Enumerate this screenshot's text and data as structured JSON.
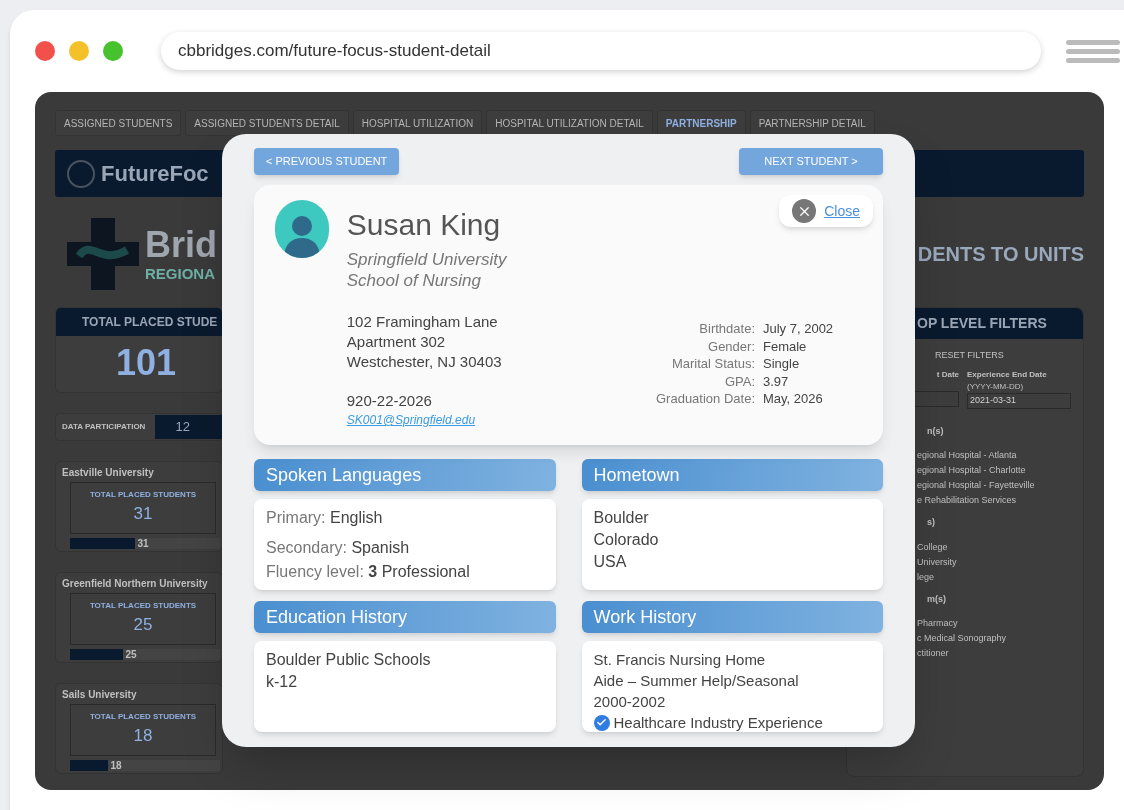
{
  "browser": {
    "url": "cbbridges.com/future-focus-student-detail"
  },
  "dashboard": {
    "tabs": [
      {
        "label": "ASSIGNED STUDENTS",
        "selected": false
      },
      {
        "label": "ASSIGNED STUDENTS DETAIL",
        "selected": false
      },
      {
        "label": "HOSPITAL UTILIZATION",
        "selected": false
      },
      {
        "label": "HOSPITAL UTILIZATION DETAIL",
        "selected": false
      },
      {
        "label": "PARTNERSHIP",
        "selected": true
      },
      {
        "label": "PARTNERSHIP DETAIL",
        "selected": false
      }
    ],
    "banner_text": "FutureFoc",
    "logo": {
      "name": "Brid",
      "subtitle": "REGIONA"
    },
    "heading": "DENTS TO UNITS",
    "total": {
      "label": "TOTAL PLACED STUDE",
      "value": "101"
    },
    "participation": {
      "label": "DATA PARTICIPATION",
      "value": "12"
    },
    "universities": [
      {
        "name": "Eastville University",
        "label": "TOTAL PLACED STUDENTS",
        "value": "31",
        "bar_value": "31",
        "level": 0.43
      },
      {
        "name": "Greenfield Northern University",
        "label": "TOTAL PLACED STUDENTS",
        "value": "25",
        "bar_value": "25",
        "level": 0.35
      },
      {
        "name": "Sails University",
        "label": "TOTAL PLACED STUDENTS",
        "value": "18",
        "bar_value": "18",
        "level": 0.25
      }
    ],
    "filters": {
      "title": "OP LEVEL FILTERS",
      "reset": "RESET FILTERS",
      "start_date_label": "t Date",
      "end_date": {
        "label": "Experience End Date",
        "hint": "(YYYY-MM-DD)",
        "value": "2021-03-31"
      },
      "items": [
        {
          "kind": "heading",
          "text": "n(s)"
        },
        {
          "kind": "item",
          "text": "egional Hospital - Atlanta"
        },
        {
          "kind": "item",
          "text": "egional Hospital - Charlotte"
        },
        {
          "kind": "item",
          "text": "egional Hospital - Fayetteville"
        },
        {
          "kind": "item",
          "text": "e Rehabilitation Services"
        },
        {
          "kind": "heading",
          "text": "s)"
        },
        {
          "kind": "item",
          "text": "College"
        },
        {
          "kind": "item",
          "text": "University"
        },
        {
          "kind": "item",
          "text": "lege"
        },
        {
          "kind": "heading",
          "text": "m(s)"
        },
        {
          "kind": "item",
          "text": "Pharmacy"
        },
        {
          "kind": "item",
          "text": "c Medical Sonography"
        },
        {
          "kind": "item",
          "text": "ctitioner"
        }
      ]
    }
  },
  "modal": {
    "previous_button": "< PREVIOUS STUDENT",
    "next_button": "NEXT STUDENT >",
    "close_label": "Close",
    "student": {
      "name": "Susan King",
      "school": [
        "Springfield University",
        "School of Nursing"
      ],
      "address": [
        "102 Framingham Lane",
        "Apartment 302",
        "Westchester, NJ 30403"
      ],
      "phone": "920-22-2026",
      "email": "SK001@Springfield.edu",
      "details": [
        {
          "label": "Birthdate:",
          "value": "July 7, 2002"
        },
        {
          "label": "Gender:",
          "value": "Female"
        },
        {
          "label": "Marital Status:",
          "value": "Single"
        },
        {
          "label": "GPA:",
          "value": "3.97"
        },
        {
          "label": "Graduation Date:",
          "value": "May, 2026"
        }
      ]
    },
    "sections": [
      {
        "kind": "languages",
        "title": "Spoken Languages",
        "rows": [
          {
            "label": "Primary:",
            "value": "English"
          },
          {
            "label": "Secondary:",
            "value": "Spanish"
          },
          {
            "label": "Fluency level:",
            "value": "**3** Professional"
          }
        ]
      },
      {
        "kind": "lines",
        "title": "Hometown",
        "lines": [
          "Boulder",
          "Colorado",
          "USA"
        ]
      },
      {
        "kind": "lines",
        "title": "Education History",
        "lines": [
          "Boulder Public Schools",
          "k-12"
        ]
      },
      {
        "kind": "work",
        "title": "Work History",
        "lines": [
          "St. Francis Nursing Home",
          "Aide – Summer Help/Seasonal",
          "2000-2002"
        ],
        "experience": {
          "text": "Healthcare Industry Experience",
          "checked": true
        }
      }
    ]
  }
}
